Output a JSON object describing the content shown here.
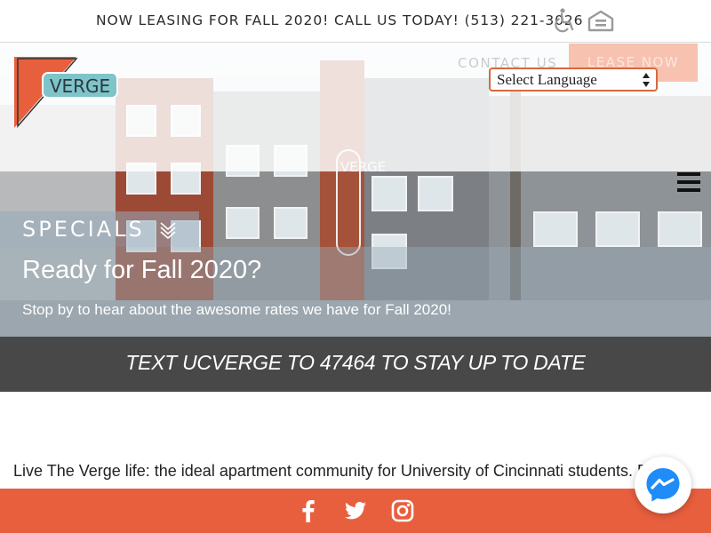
{
  "topbar": {
    "announcement": "NOW LEASING FOR FALL 2020! CALL US TODAY! (513) 221-3026",
    "icons": [
      "accessibility-icon",
      "equal-housing-icon"
    ]
  },
  "header": {
    "logo_text": "VERGE",
    "nav": {
      "contact_label": "CONTACT US",
      "lease_label": "LEASE NOW"
    },
    "language_select": {
      "selected": "Select Language"
    }
  },
  "hero": {
    "sign_text": "VERGE"
  },
  "specials": {
    "tab_label": "SPECIALS",
    "title": "Ready for Fall 2020?",
    "subtitle": "Stop by to hear about the awesome rates we have for Fall 2020!"
  },
  "text_banner": {
    "label": "TEXT UCVERGE TO 47464 TO STAY UP TO DATE"
  },
  "intro": {
    "text": "Live The Verge life: the ideal apartment community for University of Cincinnati students. E"
  },
  "footer": {
    "social": [
      "facebook-icon",
      "twitter-icon",
      "instagram-icon"
    ]
  },
  "colors": {
    "brand_orange": "#e85f3d",
    "logo_teal": "#7fc4c9",
    "banner_gray": "#484848"
  }
}
